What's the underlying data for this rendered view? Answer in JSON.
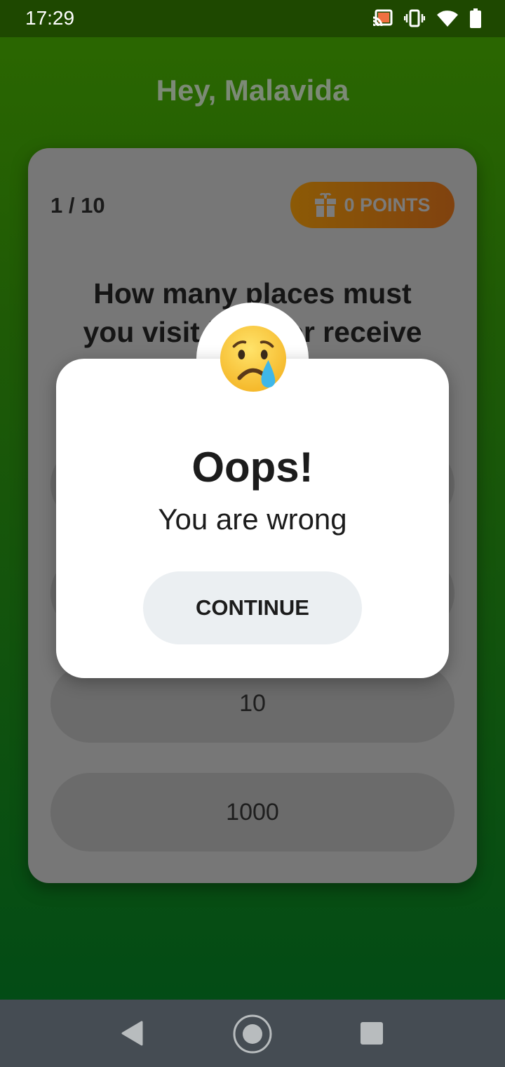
{
  "status_bar": {
    "time": "17:29",
    "icons": [
      "cast-icon",
      "vibrate-icon",
      "wifi-icon",
      "battery-icon"
    ]
  },
  "header": {
    "greeting": "Hey, Malavida"
  },
  "quiz": {
    "progress": "1 / 10",
    "points_label": "0 POINTS",
    "points_icon": "gift-icon",
    "question_lines": [
      "How many places must",
      "you visit in order receive"
    ],
    "options": [
      "",
      "",
      "10",
      "1000"
    ]
  },
  "modal": {
    "emoji": "crying-face-icon",
    "title": "Oops!",
    "message": "You are wrong",
    "continue_label": "CONTINUE"
  },
  "nav": {
    "icons": [
      "back-icon",
      "home-icon",
      "recents-icon"
    ]
  },
  "colors": {
    "points_badge": "#f7a40c",
    "modal_button": "#ebeff2",
    "background": "#2c6800"
  }
}
